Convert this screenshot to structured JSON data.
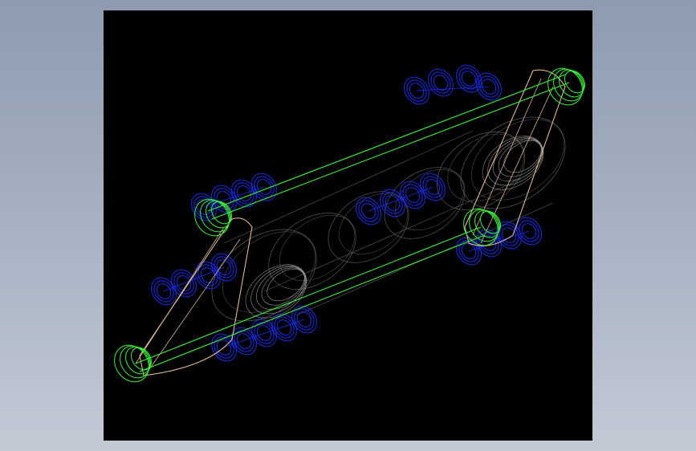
{
  "viewport": {
    "background": "#000000",
    "model": "wireframe-coupling-assembly",
    "colors": {
      "housing": "#5a5a5a",
      "bolts": "#1a2cf0",
      "link_pins": "#3cf03c",
      "link_plates": "#f2c8a0",
      "tie_rods": "#3cf03c"
    }
  }
}
